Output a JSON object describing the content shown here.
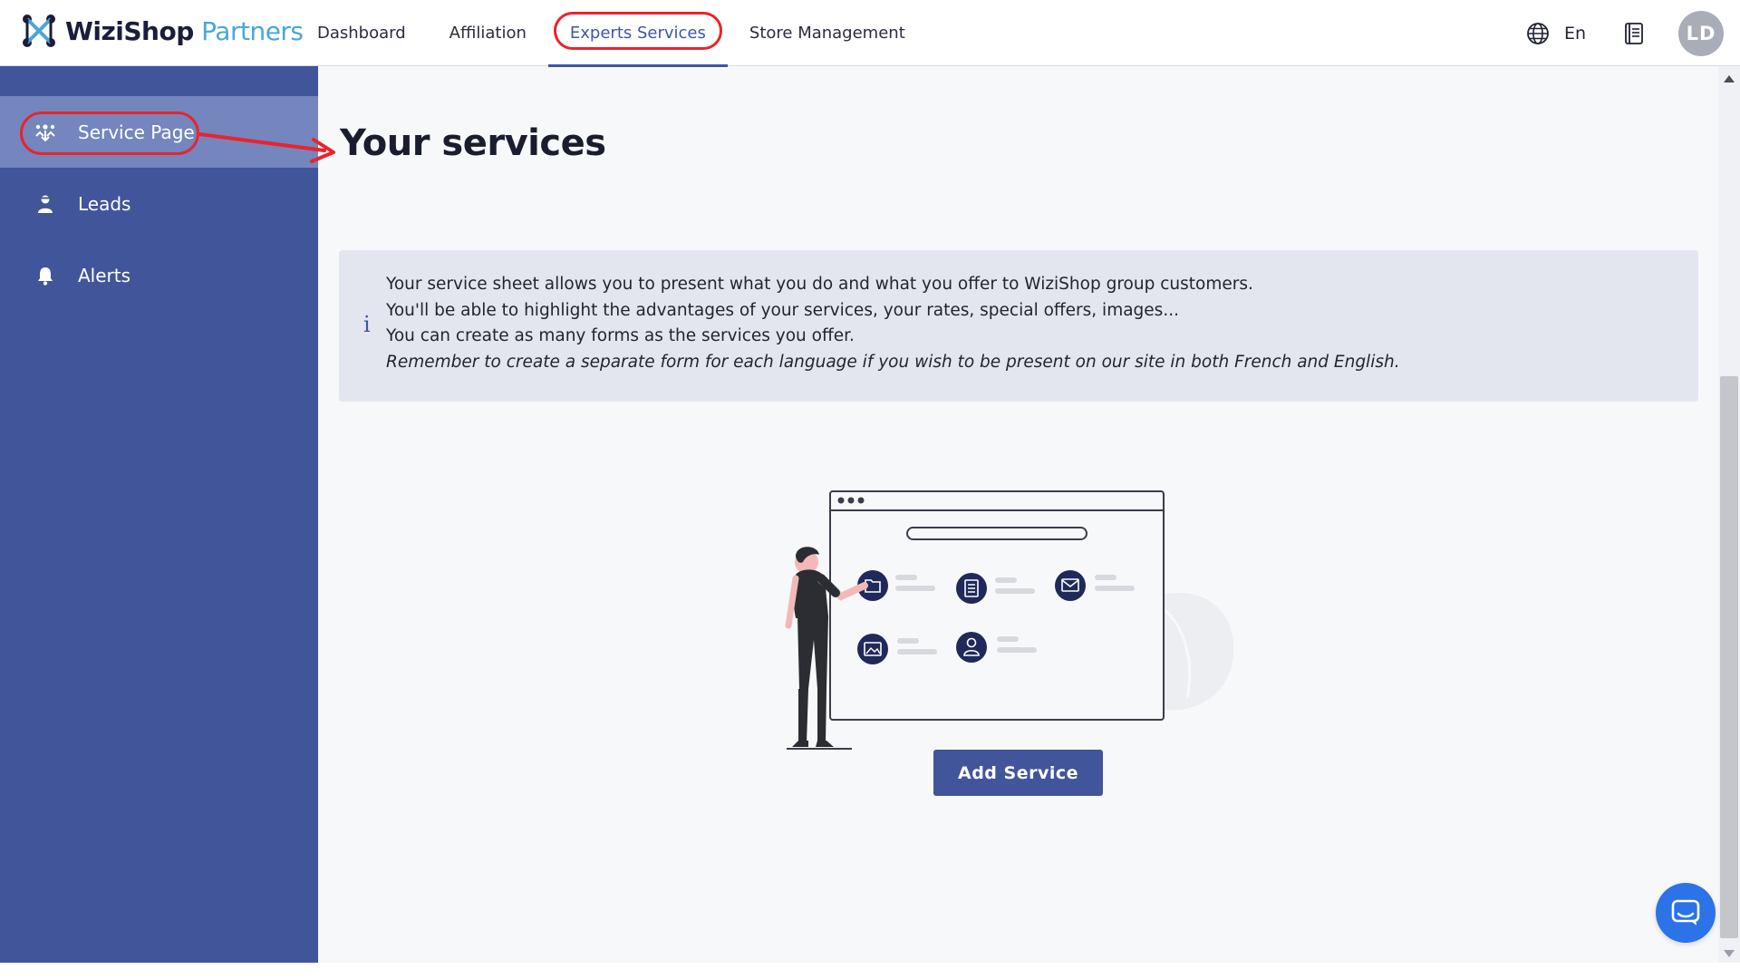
{
  "app": {
    "brand": "WiziShop",
    "brand_suffix": "Partners"
  },
  "nav": {
    "items": [
      {
        "label": "Dashboard"
      },
      {
        "label": "Affiliation"
      },
      {
        "label": "Experts Services",
        "active": true
      },
      {
        "label": "Store Management"
      }
    ],
    "language": "En",
    "avatar_initials": "LD"
  },
  "sidebar": {
    "items": [
      {
        "label": "Service Page",
        "icon": "service-page-icon",
        "active": true
      },
      {
        "label": "Leads",
        "icon": "leads-person-icon"
      },
      {
        "label": "Alerts",
        "icon": "bell-icon"
      }
    ]
  },
  "main": {
    "title": "Your services",
    "info": {
      "lines": [
        "Your service sheet allows you to present what you do and what you offer to WiziShop group customers.",
        "You'll be able to highlight the advantages of your services, your rates, special offers, images...",
        "You can create as many forms as the services you offer."
      ],
      "note": "Remember to create a separate form for each language if you wish to be present on our site in both French and English."
    },
    "add_button": "Add Service"
  },
  "colors": {
    "sidebar": "#41559a",
    "sidebar_active": "#7486bd",
    "accent": "#3f56a6",
    "highlight": "#e8242d",
    "chat": "#2b73e6",
    "illustration_dark": "#1f2a5a"
  }
}
